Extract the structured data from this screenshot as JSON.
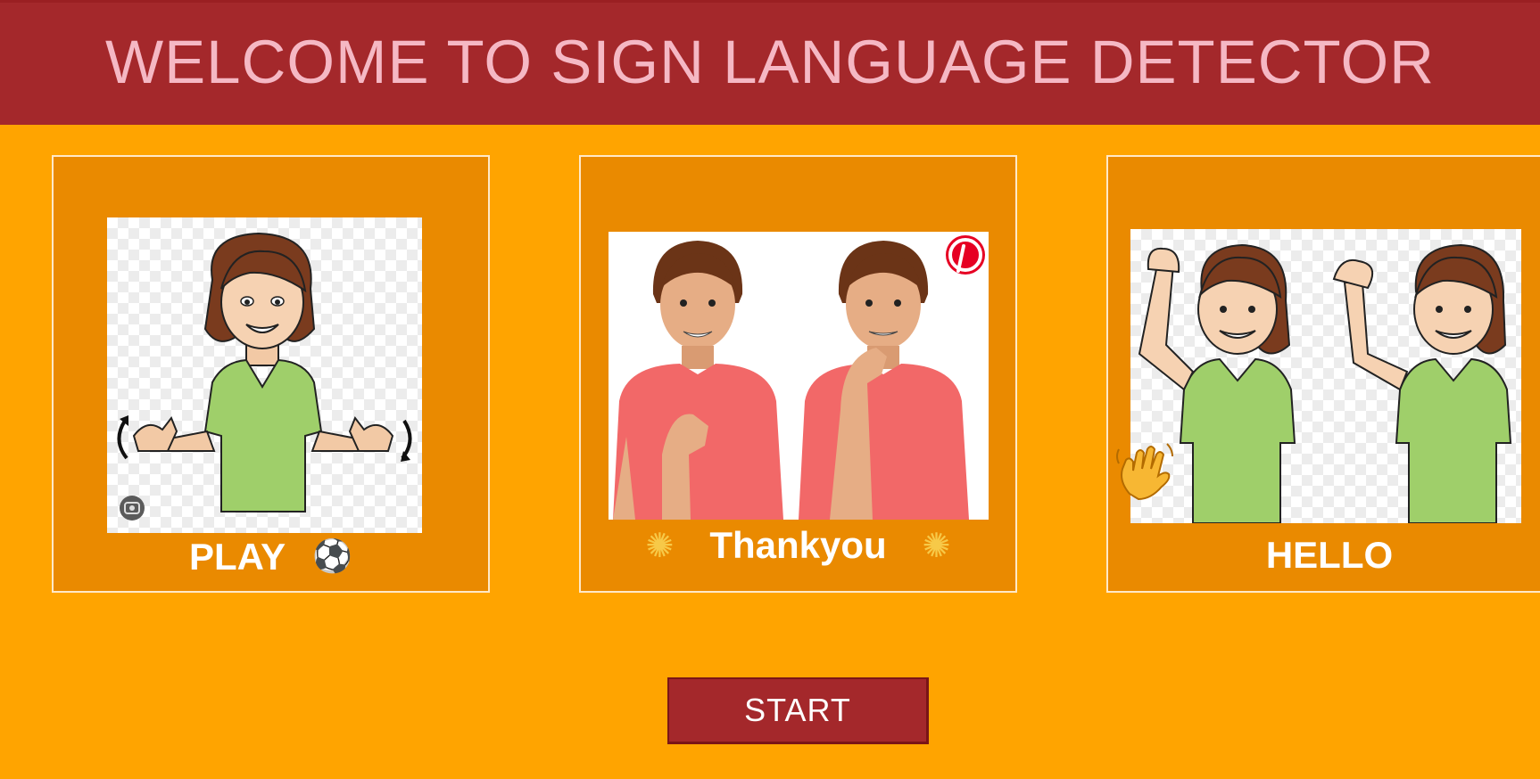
{
  "header": {
    "title": "WELCOME TO SIGN LANGUAGE DETECTOR"
  },
  "cards": [
    {
      "label": "PLAY",
      "label_icon": "soccer-ball-icon",
      "label_icon_glyph": "⚽",
      "image": "woman-signing-play-illustration"
    },
    {
      "label": "Thankyou",
      "label_icon": "sunflower-icon",
      "label_icon_glyph": "✺",
      "image": "man-signing-thank-you-illustration"
    },
    {
      "label": "HELLO",
      "label_icon": "waving-hand-icon",
      "image": "woman-signing-hello-illustration"
    }
  ],
  "start_button": {
    "label": "START"
  },
  "colors": {
    "background": "#FFA400",
    "header_bg": "#A4282B",
    "header_text": "#F5B8C4",
    "card_bg": "#EA8A00",
    "card_border": "#FFE9C8",
    "button_bg": "#A4282B",
    "button_text": "#FFFFFF"
  }
}
